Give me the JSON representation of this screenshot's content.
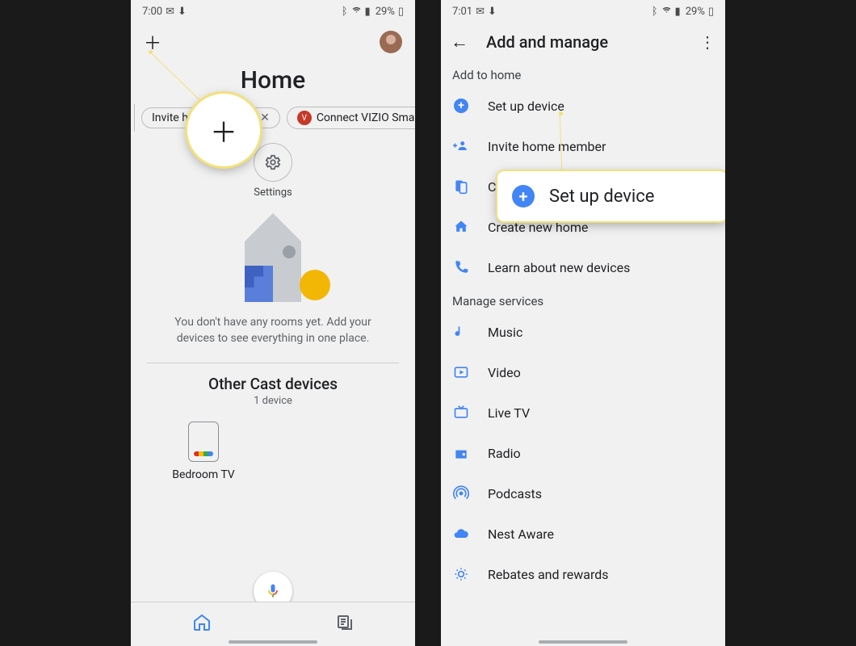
{
  "left": {
    "status": {
      "time": "7:00",
      "battery_pct": "29%"
    },
    "home_title": "Home",
    "chips": {
      "invite": "Invite home member",
      "vizio": "Connect VIZIO Smart TV"
    },
    "settings_label": "Settings",
    "no_rooms_text": "You don't have any rooms yet. Add your devices to see everything in one place.",
    "other_cast_heading": "Other Cast devices",
    "other_cast_sub": "1 device",
    "device_name": "Bedroom TV",
    "callout_plus_glyph": "＋"
  },
  "right": {
    "status": {
      "time": "7:01",
      "battery_pct": "29%"
    },
    "title": "Add and manage",
    "add_section": "Add to home",
    "items_add": [
      {
        "icon": "plus-circle",
        "label": "Set up device"
      },
      {
        "icon": "person-add",
        "label": "Invite home member"
      },
      {
        "icon": "speaker-group",
        "label": "Create speaker group"
      },
      {
        "icon": "home",
        "label": "Create new home"
      },
      {
        "icon": "phone",
        "label": "Learn about new devices"
      }
    ],
    "manage_section": "Manage services",
    "items_manage": [
      {
        "icon": "music",
        "label": "Music"
      },
      {
        "icon": "video",
        "label": "Video"
      },
      {
        "icon": "livetv",
        "label": "Live TV"
      },
      {
        "icon": "radio",
        "label": "Radio"
      },
      {
        "icon": "podcasts",
        "label": "Podcasts"
      },
      {
        "icon": "cloud",
        "label": "Nest Aware"
      },
      {
        "icon": "rebates",
        "label": "Rebates and rewards"
      }
    ],
    "callout_label": "Set up device",
    "callout_plus": "+"
  }
}
